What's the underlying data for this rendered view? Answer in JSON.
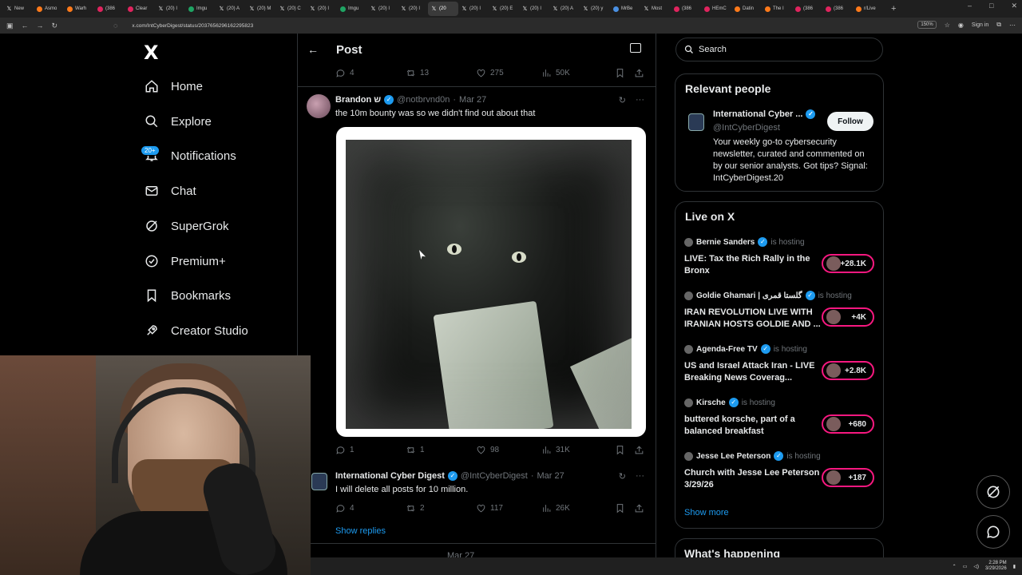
{
  "browser": {
    "tabs": [
      {
        "label": "New",
        "fav": "x"
      },
      {
        "label": "Asmo",
        "fav": "o"
      },
      {
        "label": "Warh",
        "fav": "o"
      },
      {
        "label": "(386",
        "fav": ""
      },
      {
        "label": "Clear",
        "fav": ""
      },
      {
        "label": "(20) I",
        "fav": "x"
      },
      {
        "label": "Imgu",
        "fav": "g"
      },
      {
        "label": "(20) A",
        "fav": "x"
      },
      {
        "label": "(20) M",
        "fav": "x"
      },
      {
        "label": "(20) C",
        "fav": "x"
      },
      {
        "label": "(20) I",
        "fav": "x"
      },
      {
        "label": "Imgu",
        "fav": "g"
      },
      {
        "label": "(20) I",
        "fav": "x"
      },
      {
        "label": "(20) I",
        "fav": "x"
      },
      {
        "label": "(20",
        "fav": "x",
        "active": true
      },
      {
        "label": "(20) I",
        "fav": "x"
      },
      {
        "label": "(20) E",
        "fav": "x"
      },
      {
        "label": "(20) I",
        "fav": "x"
      },
      {
        "label": "(20) A",
        "fav": "x"
      },
      {
        "label": "(20) y",
        "fav": "x"
      },
      {
        "label": "MrBe",
        "fav": "b"
      },
      {
        "label": "Most",
        "fav": "x"
      },
      {
        "label": "(386",
        "fav": ""
      },
      {
        "label": "HEmC",
        "fav": ""
      },
      {
        "label": "Datin",
        "fav": "o"
      },
      {
        "label": "The I",
        "fav": "o"
      },
      {
        "label": "(386",
        "fav": ""
      },
      {
        "label": "(386",
        "fav": ""
      },
      {
        "label": "r/Live",
        "fav": "o"
      }
    ],
    "url": "x.com/IntCyberDigest/status/2037656296162295823",
    "zoom": "150%",
    "signin": "Sign in"
  },
  "nav": {
    "logo": "X",
    "items": [
      {
        "label": "Home",
        "icon": "home-icon"
      },
      {
        "label": "Explore",
        "icon": "search-icon"
      },
      {
        "label": "Notifications",
        "icon": "bell-icon"
      },
      {
        "label": "Chat",
        "icon": "mail-icon"
      },
      {
        "label": "SuperGrok",
        "icon": "grok-icon"
      },
      {
        "label": "Premium+",
        "icon": "verified-icon"
      },
      {
        "label": "Bookmarks",
        "icon": "bookmark-icon"
      },
      {
        "label": "Creator Studio",
        "icon": "rocket-icon"
      }
    ],
    "notifications_badge": "20+"
  },
  "main": {
    "header_title": "Post",
    "top_actions": {
      "replies": "4",
      "reposts": "13",
      "likes": "275",
      "views": "50K"
    },
    "reply1": {
      "name": "Brandon ש",
      "handle": "@notbrvnd0n",
      "date": "Mar 27",
      "text": "the 10m bounty was so we didn't find out about that",
      "replies": "1",
      "reposts": "1",
      "likes": "98",
      "views": "31K"
    },
    "reply2": {
      "name": "International Cyber Digest",
      "handle": "@IntCyberDigest",
      "date": "Mar 27",
      "text": "I will delete all posts for 10 million.",
      "replies": "4",
      "reposts": "2",
      "likes": "117",
      "views": "26K"
    },
    "show_replies": "Show replies",
    "reply3_date": "Mar 27"
  },
  "sidebar": {
    "search_placeholder": "Search",
    "relevant_title": "Relevant people",
    "person": {
      "name": "International Cyber ...",
      "handle": "@IntCyberDigest",
      "bio": "Your weekly go-to cybersecurity newsletter, curated and commented on by our senior analysts. Got tips? Signal: IntCyberDigest.20",
      "follow": "Follow"
    },
    "live_title": "Live on X",
    "live": [
      {
        "host": "Bernie Sanders",
        "title": "LIVE: Tax the Rich Rally in the Bronx",
        "count": "+28.1K"
      },
      {
        "host": "Goldie Ghamari | گلستا قمری",
        "title": "IRAN REVOLUTION LIVE WITH IRANIAN HOSTS GOLDIE AND ...",
        "count": "+4K"
      },
      {
        "host": "Agenda-Free TV",
        "title": "US and Israel Attack Iran - LIVE Breaking News Coverag...",
        "count": "+2.8K"
      },
      {
        "host": "Kirsche",
        "title": "buttered korsche, part of a balanced breakfast",
        "count": "+680"
      },
      {
        "host": "Jesse Lee Peterson",
        "title": "Church with Jesse Lee Peterson 3/29/26",
        "count": "+187"
      }
    ],
    "is_hosting": "is hosting",
    "show_more": "Show more",
    "whats_happening": "What's happening"
  },
  "taskbar": {
    "time": "2:28 PM",
    "date": "3/29/2026"
  }
}
